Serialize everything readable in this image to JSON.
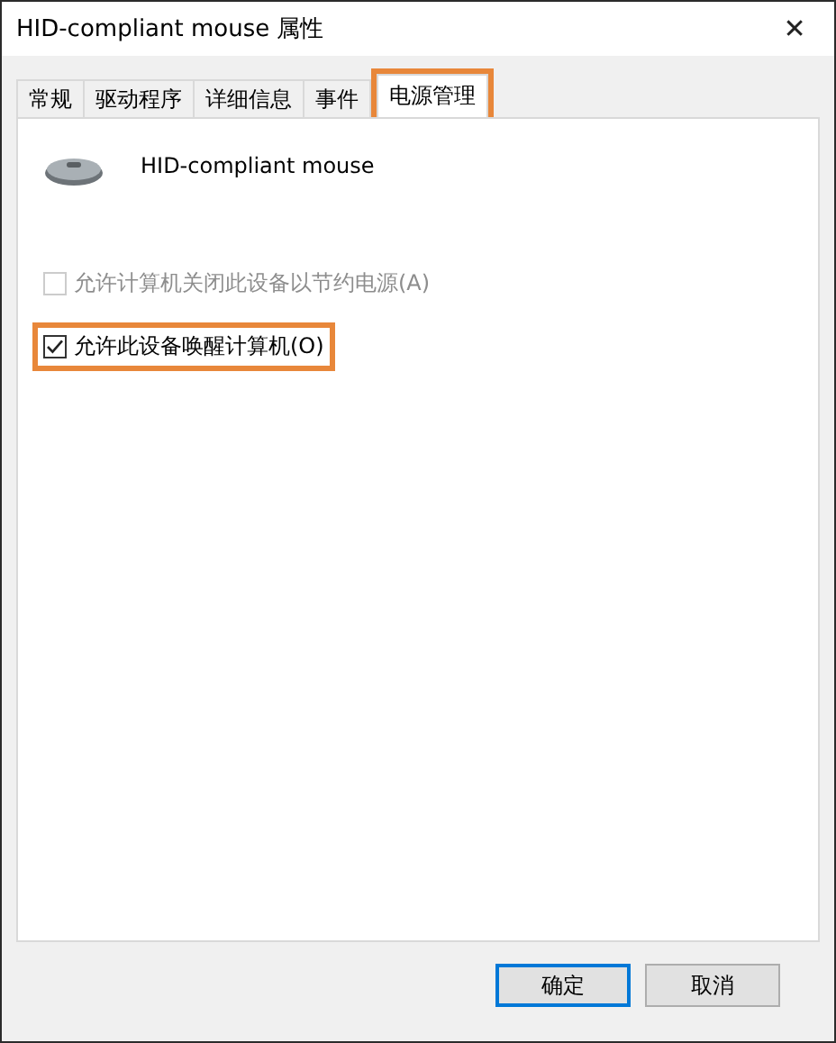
{
  "window": {
    "title": "HID-compliant mouse 属性",
    "close": "✕"
  },
  "tabs": [
    {
      "label": "常规",
      "selected": false,
      "highlighted": false
    },
    {
      "label": "驱动程序",
      "selected": false,
      "highlighted": false
    },
    {
      "label": "详细信息",
      "selected": false,
      "highlighted": false
    },
    {
      "label": "事件",
      "selected": false,
      "highlighted": false
    },
    {
      "label": "电源管理",
      "selected": true,
      "highlighted": true
    }
  ],
  "device": {
    "name": "HID-compliant mouse"
  },
  "options": [
    {
      "label": "允许计算机关闭此设备以节约电源(A)",
      "checked": false,
      "disabled": true,
      "highlighted": false
    },
    {
      "label": "允许此设备唤醒计算机(O)",
      "checked": true,
      "disabled": false,
      "highlighted": true
    }
  ],
  "buttons": [
    {
      "label": "确定",
      "default": true
    },
    {
      "label": "取消",
      "default": false
    }
  ]
}
